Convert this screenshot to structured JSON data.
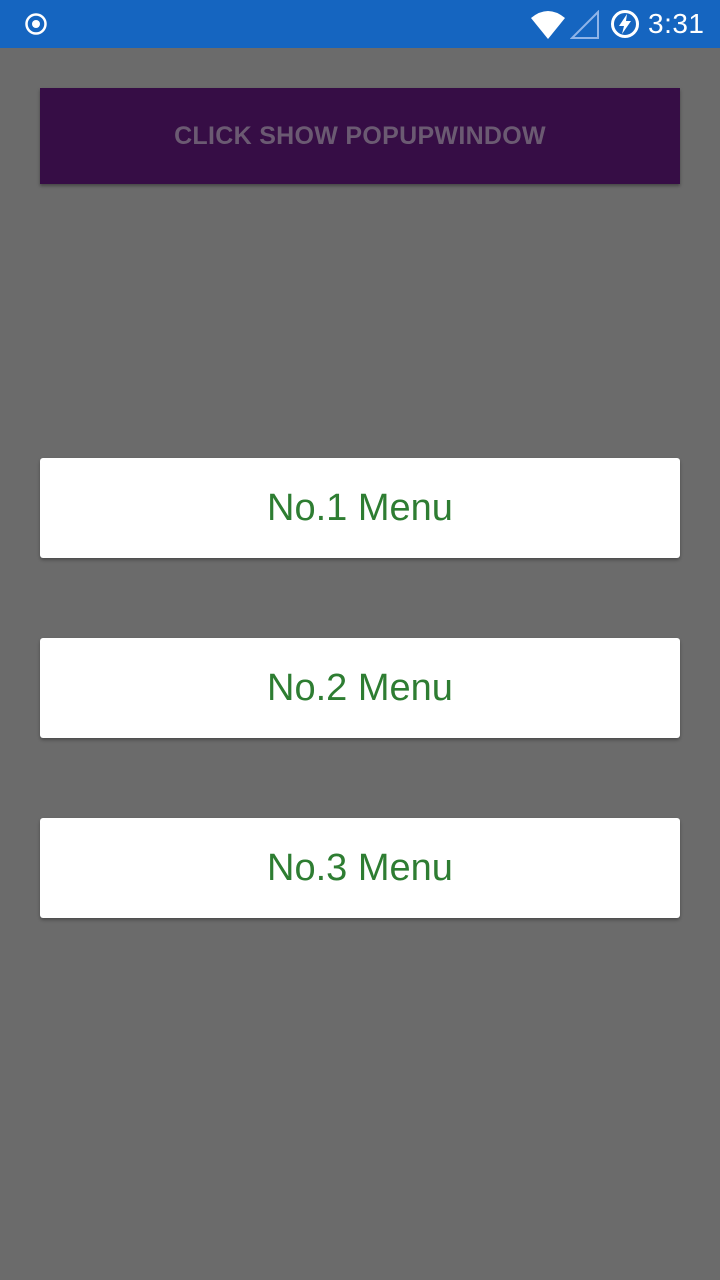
{
  "status_bar": {
    "time": "3:31",
    "icons": [
      "record-icon",
      "wifi-icon",
      "signal-icon",
      "battery-charging-icon"
    ]
  },
  "main_button": {
    "label": "CLICK SHOW POPUPWINDOW"
  },
  "popup": {
    "items": [
      {
        "label": "No.1 Menu"
      },
      {
        "label": "No.2 Menu"
      },
      {
        "label": "No.3 Menu"
      }
    ]
  },
  "colors": {
    "status_bar": "#1565c0",
    "overlay_background": "#6b6b6b",
    "button_background": "#360d45",
    "menu_text": "#2e7d32"
  }
}
